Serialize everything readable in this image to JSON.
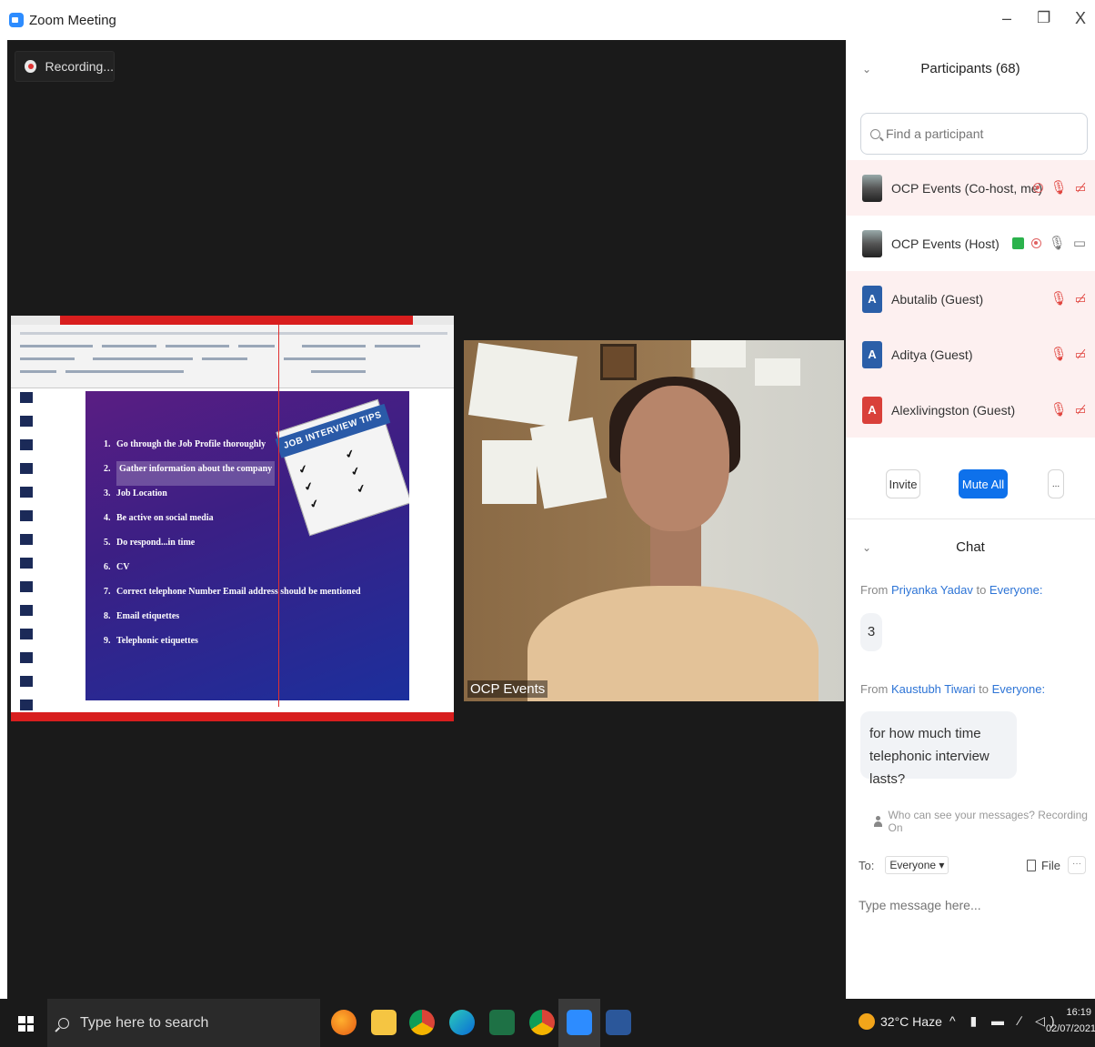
{
  "window": {
    "title": "Zoom Meeting",
    "minimize": "–",
    "restore": "❐",
    "close": "X"
  },
  "meeting": {
    "recording_label": "Recording...",
    "video_name": "OCP Events"
  },
  "slide": {
    "card_title": "JOB INTERVIEW TIPS",
    "items": [
      {
        "num": "1.",
        "text": "Go through the Job Profile thoroughly"
      },
      {
        "num": "2.",
        "text": "Gather information about the company"
      },
      {
        "num": "3.",
        "text": "Job Location"
      },
      {
        "num": "4.",
        "text": "Be active on social media"
      },
      {
        "num": "5.",
        "text": "Do respond...in time"
      },
      {
        "num": "6.",
        "text": "CV"
      },
      {
        "num": "7.",
        "text": "Correct telephone Number Email address should be mentioned"
      },
      {
        "num": "8.",
        "text": "Email etiquettes"
      },
      {
        "num": "9.",
        "text": "Telephonic etiquettes"
      }
    ]
  },
  "participants": {
    "header": "Participants (68)",
    "search_placeholder": "Find a participant",
    "list": [
      {
        "initial": "",
        "name": "OCP Events (Co-host, me)",
        "avatar_color": "",
        "muted": true
      },
      {
        "initial": "",
        "name": "OCP Events (Host)",
        "avatar_color": "",
        "muted": false
      },
      {
        "initial": "A",
        "name": "Abutalib (Guest)",
        "avatar_color": "#2b5fa8",
        "muted": true
      },
      {
        "initial": "A",
        "name": "Aditya (Guest)",
        "avatar_color": "#2b5fa8",
        "muted": true
      },
      {
        "initial": "A",
        "name": "Alexlivingston (Guest)",
        "avatar_color": "#d9403a",
        "muted": true
      }
    ],
    "invite_label": "Invite",
    "mute_all_label": "Mute All",
    "more_label": "..."
  },
  "chat": {
    "header": "Chat",
    "messages": [
      {
        "from_prefix": "From",
        "from": "Priyanka Yadav",
        "to_prefix": "to",
        "to": "Everyone:",
        "text": "3"
      },
      {
        "from_prefix": "From",
        "from": "Kaustubh Tiwari",
        "to_prefix": "to",
        "to": "Everyone:",
        "text_line1": "for how much time",
        "text_line2": "telephonic interview lasts?"
      }
    ],
    "visibility_text": "Who can see your messages? Recording On",
    "to_label": "To:",
    "to_value": "Everyone ▾",
    "file_label": "File",
    "more_dots": "···",
    "input_placeholder": "Type message here..."
  },
  "taskbar": {
    "search_placeholder": "Type here to search",
    "weather": "32°C Haze",
    "tray_icons": "^ ▮ ▬ ∕ ◁)",
    "time": "16:19",
    "date": "02/07/2021"
  },
  "colors": {
    "zoom_blue": "#0e71eb",
    "muted_red": "#e0443e",
    "panel_muted_bg": "#fdf0f0"
  }
}
